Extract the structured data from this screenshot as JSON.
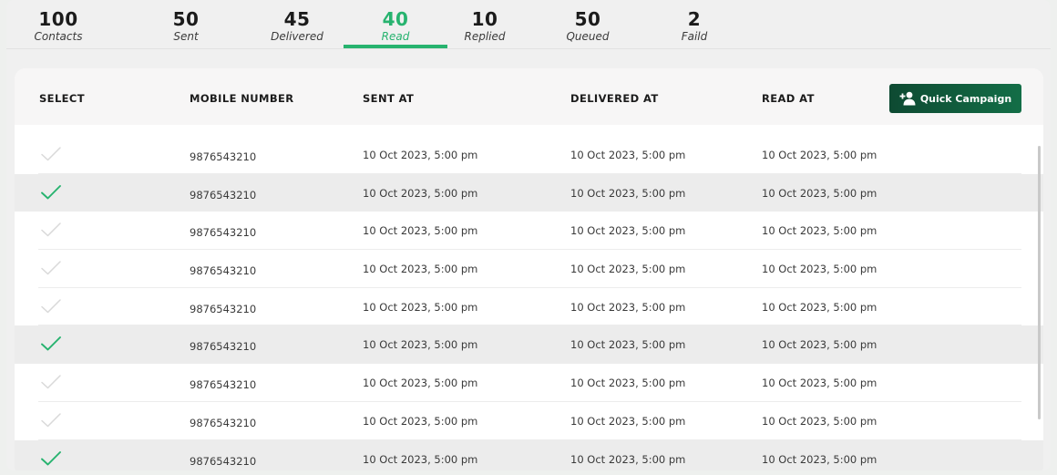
{
  "stats": [
    {
      "value": "100",
      "label": "Contacts"
    },
    {
      "value": "50",
      "label": "Sent"
    },
    {
      "value": "45",
      "label": "Delivered"
    },
    {
      "value": "40",
      "label": "Read"
    },
    {
      "value": "10",
      "label": "Replied"
    },
    {
      "value": "50",
      "label": "Queued"
    },
    {
      "value": "2",
      "label": "Faild"
    }
  ],
  "active_tab": "Read",
  "table": {
    "headers": {
      "select": "SELECT",
      "mobile": "MOBILE NUMBER",
      "sent": "SENT AT",
      "delivered": "DELIVERED AT",
      "read": "READ AT"
    },
    "quick_campaign_label": "Quick Campaign",
    "rows": [
      {
        "selected": false,
        "mobile": "9876543210",
        "sent_at": "10 Oct 2023, 5:00 pm",
        "delivered_at": "10 Oct 2023, 5:00 pm",
        "read_at": "10 Oct 2023, 5:00 pm"
      },
      {
        "selected": true,
        "mobile": "9876543210",
        "sent_at": "10 Oct 2023, 5:00 pm",
        "delivered_at": "10 Oct 2023, 5:00 pm",
        "read_at": "10 Oct 2023, 5:00 pm"
      },
      {
        "selected": false,
        "mobile": "9876543210",
        "sent_at": "10 Oct 2023, 5:00 pm",
        "delivered_at": "10 Oct 2023, 5:00 pm",
        "read_at": "10 Oct 2023, 5:00 pm"
      },
      {
        "selected": false,
        "mobile": "9876543210",
        "sent_at": "10 Oct 2023, 5:00 pm",
        "delivered_at": "10 Oct 2023, 5:00 pm",
        "read_at": "10 Oct 2023, 5:00 pm"
      },
      {
        "selected": false,
        "mobile": "9876543210",
        "sent_at": "10 Oct 2023, 5:00 pm",
        "delivered_at": "10 Oct 2023, 5:00 pm",
        "read_at": "10 Oct 2023, 5:00 pm"
      },
      {
        "selected": true,
        "mobile": "9876543210",
        "sent_at": "10 Oct 2023, 5:00 pm",
        "delivered_at": "10 Oct 2023, 5:00 pm",
        "read_at": "10 Oct 2023, 5:00 pm"
      },
      {
        "selected": false,
        "mobile": "9876543210",
        "sent_at": "10 Oct 2023, 5:00 pm",
        "delivered_at": "10 Oct 2023, 5:00 pm",
        "read_at": "10 Oct 2023, 5:00 pm"
      },
      {
        "selected": false,
        "mobile": "9876543210",
        "sent_at": "10 Oct 2023, 5:00 pm",
        "delivered_at": "10 Oct 2023, 5:00 pm",
        "read_at": "10 Oct 2023, 5:00 pm"
      },
      {
        "selected": true,
        "mobile": "9876543210",
        "sent_at": "10 Oct 2023, 5:00 pm",
        "delivered_at": "10 Oct 2023, 5:00 pm",
        "read_at": "10 Oct 2023, 5:00 pm"
      }
    ]
  },
  "colors": {
    "accent": "#27b36f",
    "button_dark": "#0e4a32",
    "check_on": "#27b36f",
    "check_off": "#d9d9d9"
  },
  "icons": {
    "quick_campaign": "add-user-icon",
    "row_select": "checkmark-icon"
  }
}
